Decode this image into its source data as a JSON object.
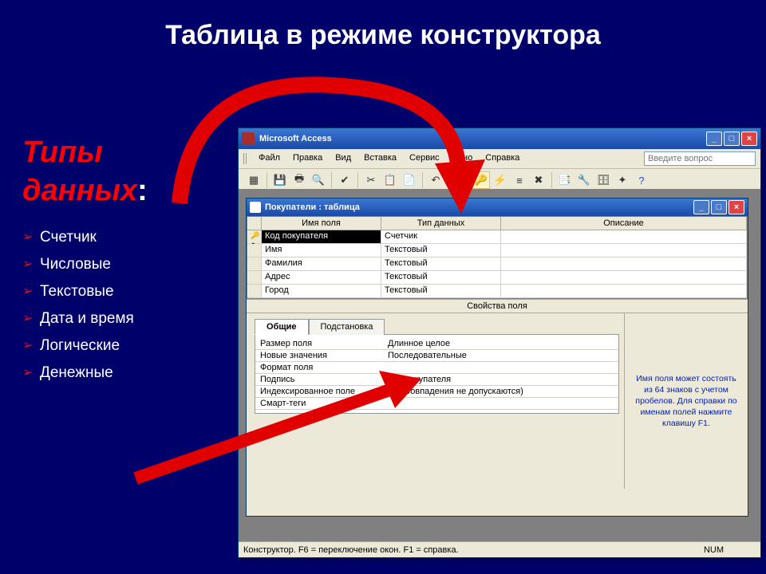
{
  "slide": {
    "title": "Таблица в режиме конструктора",
    "types_heading": "Типы данных",
    "type_items": [
      "Счетчик",
      "Числовые",
      "Текстовые",
      "Дата и время",
      "Логические",
      "Денежные"
    ]
  },
  "app": {
    "title": "Microsoft Access",
    "menu": [
      "Файл",
      "Правка",
      "Вид",
      "Вставка",
      "Сервис",
      "Окно",
      "Справка"
    ],
    "ask_placeholder": "Введите вопрос"
  },
  "inner": {
    "title": "Покупатели : таблица",
    "columns": {
      "name": "Имя поля",
      "type": "Тип данных",
      "desc": "Описание"
    },
    "rows": [
      {
        "key": true,
        "name": "Код покупателя",
        "type": "Счетчик"
      },
      {
        "key": false,
        "name": "Имя",
        "type": "Текстовый"
      },
      {
        "key": false,
        "name": "Фамилия",
        "type": "Текстовый"
      },
      {
        "key": false,
        "name": "Адрес",
        "type": "Текстовый"
      },
      {
        "key": false,
        "name": "Город",
        "type": "Текстовый"
      }
    ],
    "props_label": "Свойства поля",
    "tabs": {
      "general": "Общие",
      "lookup": "Подстановка"
    },
    "props": [
      {
        "label": "Размер поля",
        "value": "Длинное целое"
      },
      {
        "label": "Новые значения",
        "value": "Последовательные"
      },
      {
        "label": "Формат поля",
        "value": ""
      },
      {
        "label": "Подпись",
        "value": "Код покупателя"
      },
      {
        "label": "Индексированное поле",
        "value": "Да (Совпадения не допускаются)"
      },
      {
        "label": "Смарт-теги",
        "value": ""
      }
    ],
    "hint": "Имя поля может состоять из 64 знаков с учетом пробелов. Для справки по именам полей нажмите клавишу F1."
  },
  "status": {
    "left": "Конструктор.  F6 = переключение окон.  F1 = справка.",
    "right": "NUM"
  }
}
